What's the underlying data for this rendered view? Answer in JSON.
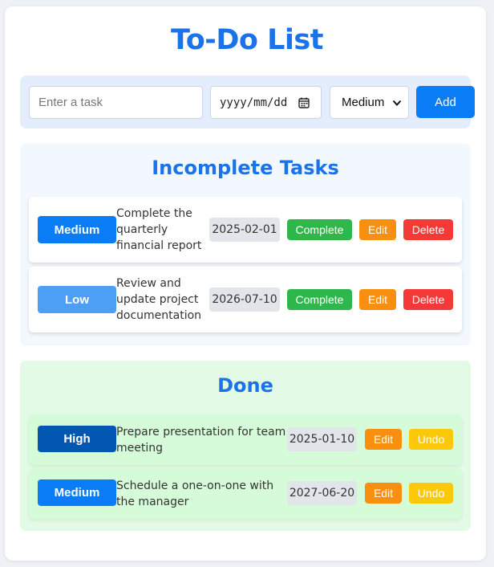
{
  "app": {
    "title": "To-Do List"
  },
  "form": {
    "task_placeholder": "Enter a task",
    "date_placeholder": "yyyy/mm/dd",
    "priority_selected": "Medium",
    "add_label": "Add"
  },
  "colors": {
    "accent": "#1a73e8",
    "priority_high": "#0257b2",
    "priority_medium": "#0a7cf5",
    "priority_low": "#4d9ff5",
    "complete": "#2eb84b",
    "edit": "#f98f0e",
    "delete": "#f43a36",
    "undo": "#fbc80a"
  },
  "incomplete": {
    "heading": "Incomplete Tasks",
    "tasks": [
      {
        "priority": "Medium",
        "text_lines": [
          "Complete the",
          "quarterly",
          "financial report"
        ],
        "due": "2025-02-01",
        "complete_label": "Complete",
        "edit_label": "Edit",
        "delete_label": "Delete"
      },
      {
        "priority": "Low",
        "text_lines": [
          "Review and",
          "update project",
          "documentation"
        ],
        "due": "2026-07-10",
        "complete_label": "Complete",
        "edit_label": "Edit",
        "delete_label": "Delete"
      }
    ]
  },
  "done": {
    "heading": "Done",
    "tasks": [
      {
        "priority": "High",
        "text_lines": [
          "Prepare presentation for team",
          "meeting"
        ],
        "due": "2025-01-10",
        "edit_label": "Edit",
        "undo_label": "Undo"
      },
      {
        "priority": "Medium",
        "text_lines": [
          "Schedule a one-on-one with",
          "the manager"
        ],
        "due": "2027-06-20",
        "edit_label": "Edit",
        "undo_label": "Undo"
      }
    ]
  }
}
